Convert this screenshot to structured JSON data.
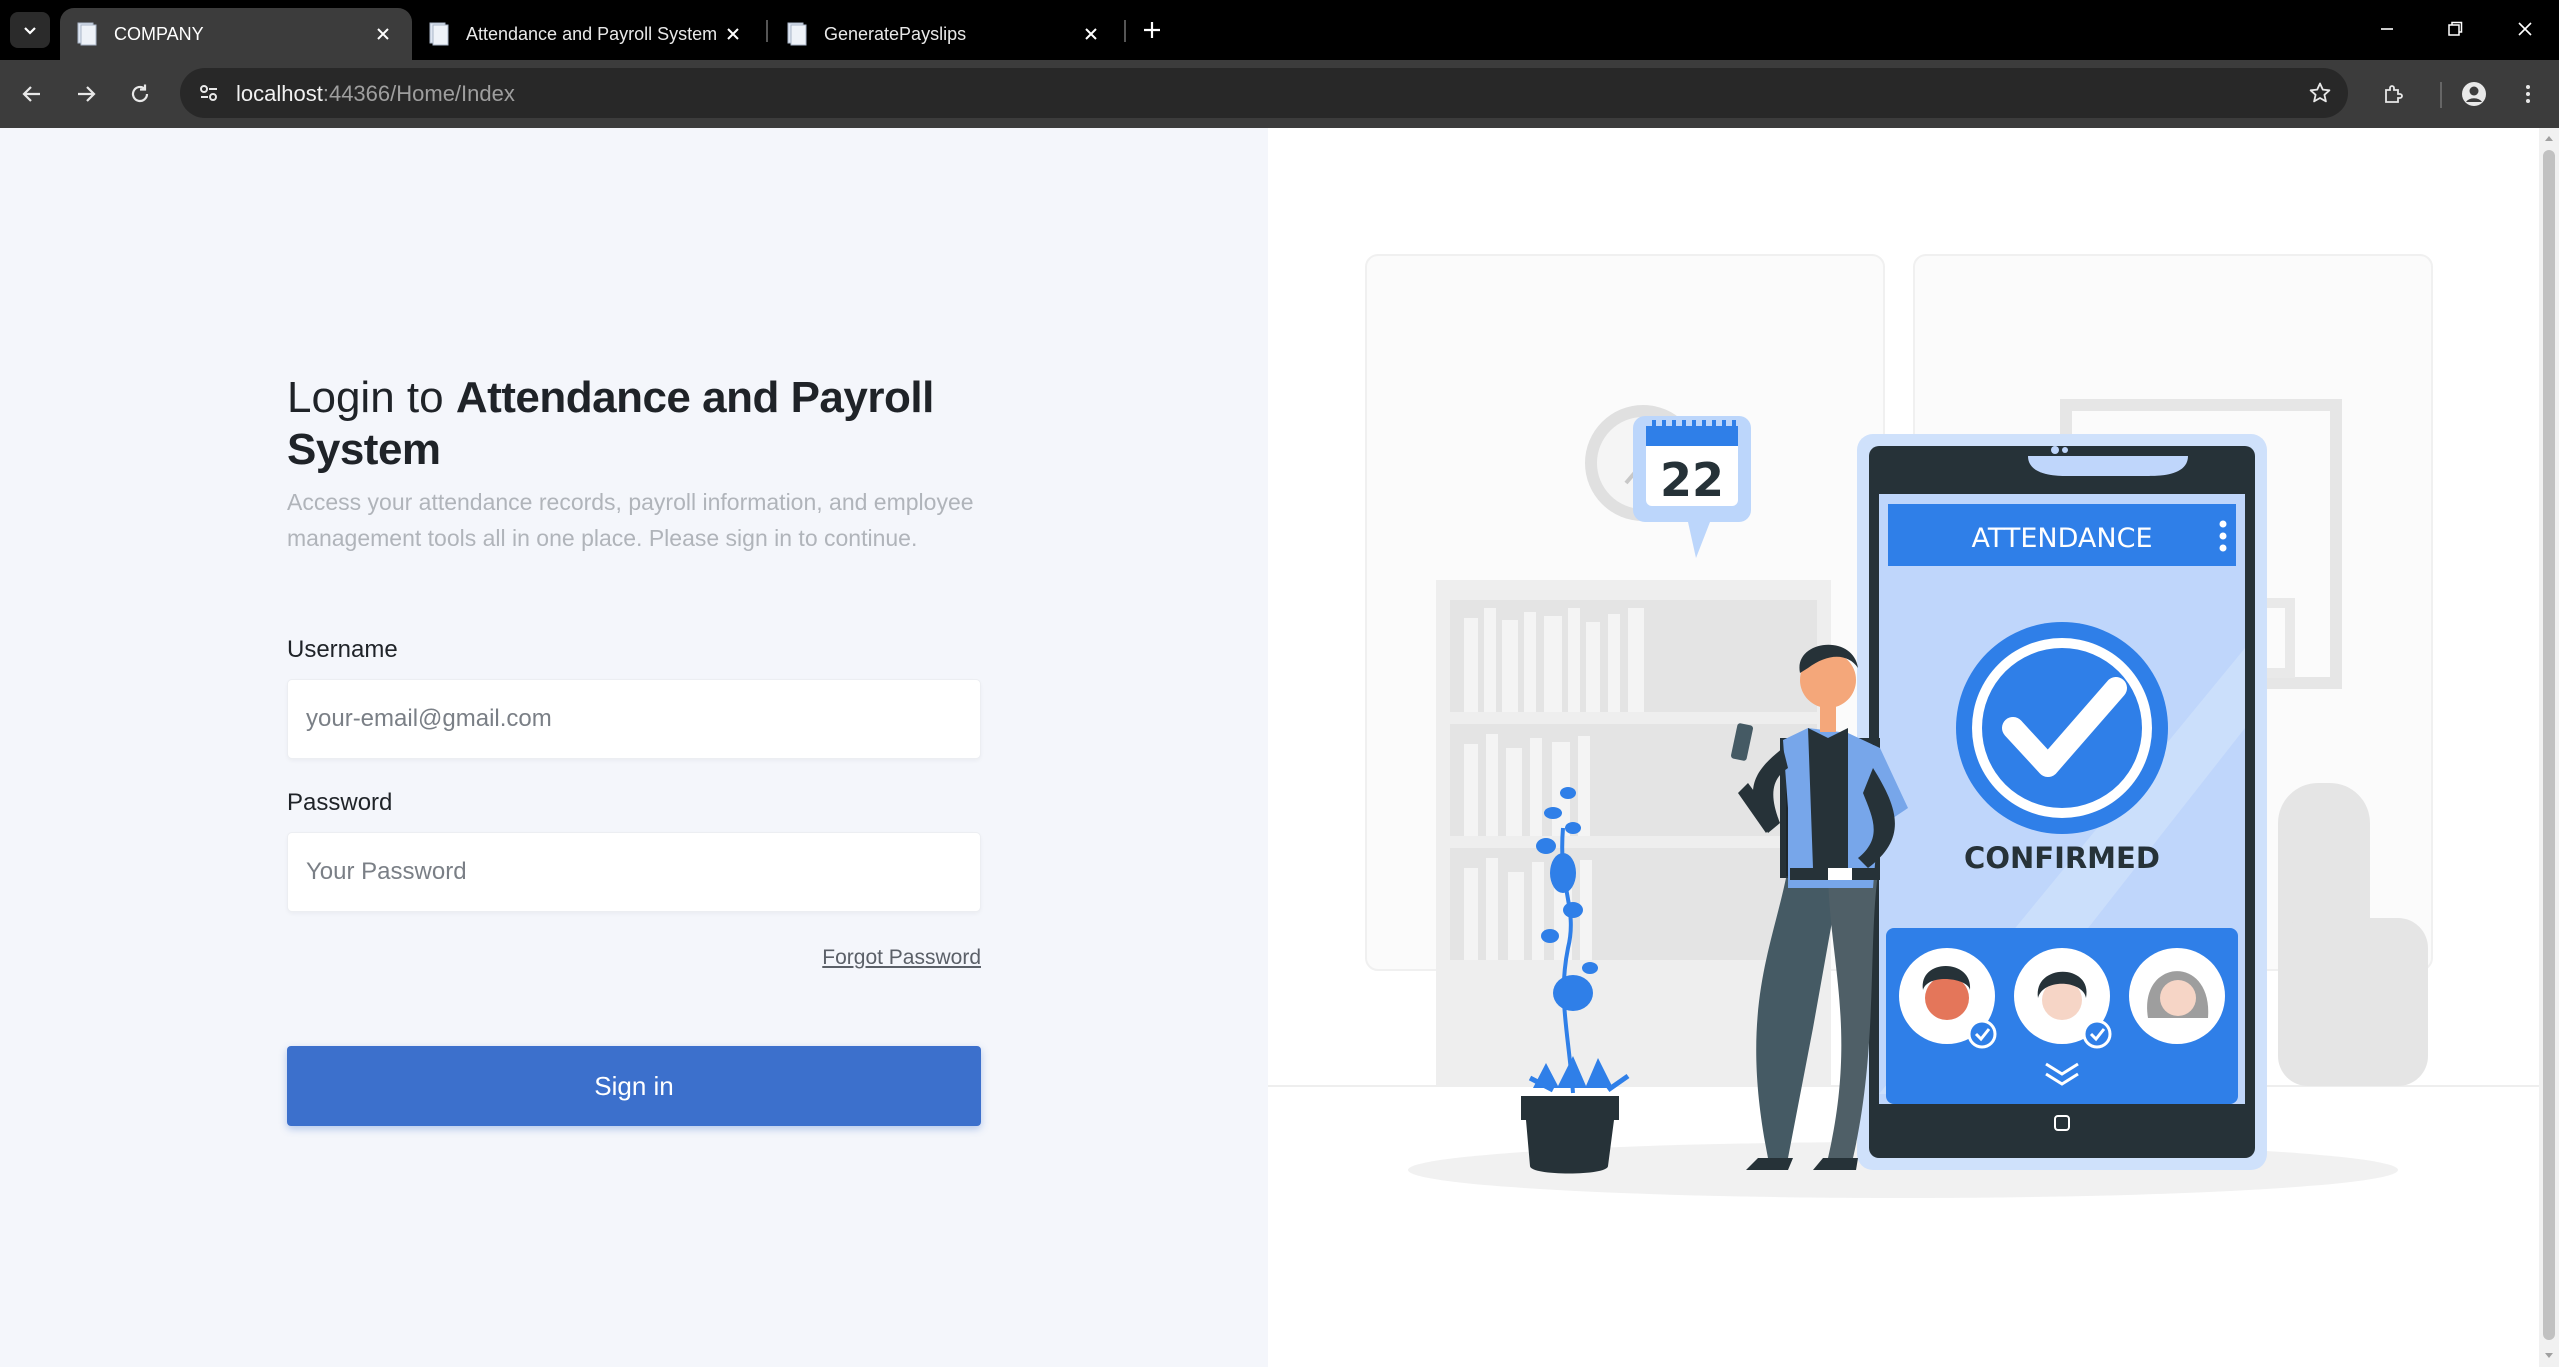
{
  "browser": {
    "tabs": [
      {
        "title": "COMPANY",
        "active": true
      },
      {
        "title": "Attendance and Payroll System",
        "active": false
      },
      {
        "title": "GeneratePayslips",
        "active": false
      }
    ],
    "url_host": "localhost",
    "url_rest": ":44366/Home/Index"
  },
  "login": {
    "title_prefix": "Login to ",
    "title_strong": "Attendance and Payroll System",
    "subtitle": "Access your attendance records, payroll information, and employee management tools all in one place. Please sign in to continue.",
    "username_label": "Username",
    "username_placeholder": "your-email@gmail.com",
    "password_label": "Password",
    "password_placeholder": "Your Password",
    "forgot_label": "Forgot Password",
    "signin_label": "Sign in"
  },
  "illustration": {
    "calendar_day": "22",
    "phone_header": "ATTENDANCE",
    "phone_status": "CONFIRMED",
    "accent_color": "#2f7fe8"
  },
  "colors": {
    "primary": "#3c70cc",
    "left_panel_bg": "#f4f6fb",
    "chrome_bg": "#3c3c3c"
  }
}
